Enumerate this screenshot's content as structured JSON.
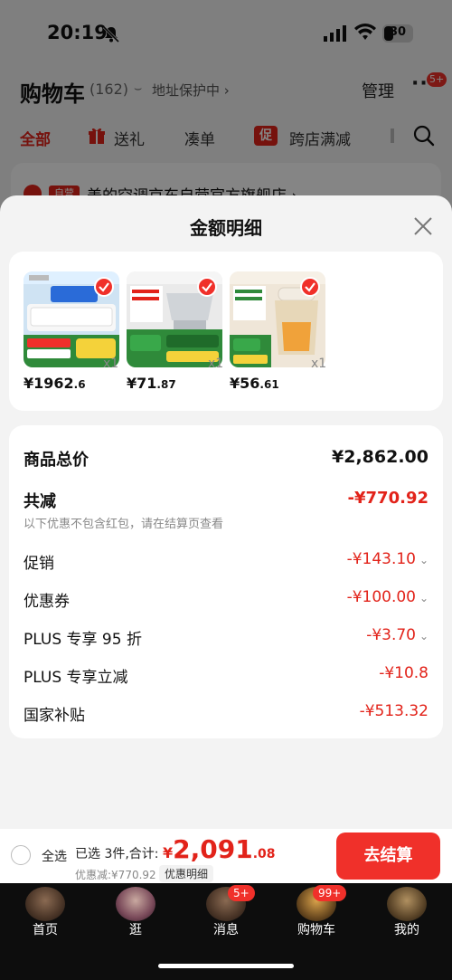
{
  "status_bar": {
    "time": "20:19",
    "battery": "30"
  },
  "cart_header": {
    "title": "购物车",
    "count": "(162)",
    "address": "地址保护中 ›",
    "manage": "管理",
    "more_badge": "5+"
  },
  "filter_tabs": {
    "all": "全部",
    "gift": "送礼",
    "bundle": "凑单",
    "promo_tag": "促",
    "cross_store": "跨店满减"
  },
  "store": {
    "badge": "自营",
    "name": "美的空调京东自营官方旗舰店 ›"
  },
  "sheet": {
    "title": "金额明细",
    "products": [
      {
        "price_int": "¥1962",
        "price_dec": ".6",
        "qty": "x1"
      },
      {
        "price_int": "¥71",
        "price_dec": ".87",
        "qty": "x1"
      },
      {
        "price_int": "¥56",
        "price_dec": ".61",
        "qty": "x1"
      }
    ],
    "rows": {
      "total_label": "商品总价",
      "total_value": "¥2,862.00",
      "reduce_label": "共减",
      "reduce_value": "-¥770.92",
      "note": "以下优惠不包含红包，请在结算页查看",
      "promo_label": "促销",
      "promo_value": "-¥143.10",
      "coupon_label": "优惠券",
      "coupon_value": "-¥100.00",
      "plus95_label": "PLUS 专享 95 折",
      "plus95_value": "-¥3.70",
      "plusdirect_label": "PLUS 专享立减",
      "plusdirect_value": "-¥10.8",
      "subsidy_label": "国家补贴",
      "subsidy_value": "-¥513.32"
    }
  },
  "checkout": {
    "select_all": "全选",
    "selected": "已选 3件,合计:",
    "currency": "¥",
    "total_int": "2,091",
    "total_dec": ".08",
    "discount": "优惠减:¥770.92",
    "detail": "优惠明细",
    "button": "去结算"
  },
  "tab_bar": {
    "home": "首页",
    "browse": "逛",
    "messages": "消息",
    "messages_badge": "5+",
    "cart": "购物车",
    "cart_badge": "99+",
    "me": "我的"
  },
  "colors": {
    "accent": "#e2231a",
    "button": "#f0302a"
  }
}
